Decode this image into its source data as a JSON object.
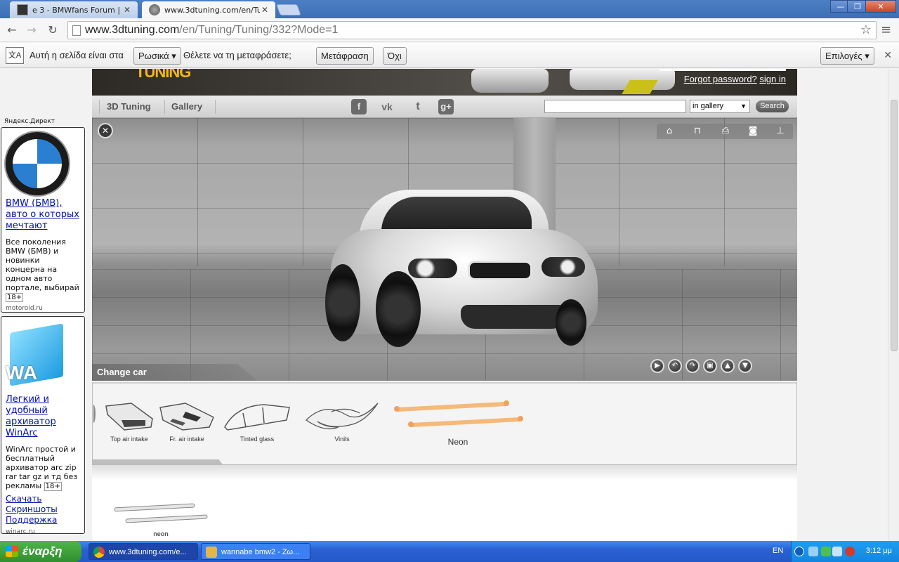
{
  "browser": {
    "tabs": [
      {
        "label": "e 3 - BMWfans Forum | | | | |",
        "active": false
      },
      {
        "label": "www.3dtuning.com/en/Tunin",
        "active": true
      }
    ],
    "url_host": "www.3dtuning.com",
    "url_path": "/en/Tuning/Tuning/332?Mode=1",
    "window_controls": {
      "minimize": "—",
      "maximize": "❐",
      "close": "✕"
    },
    "translate_bar": {
      "icon": "文A",
      "text_prefix": "Αυτή η σελίδα είναι στα",
      "language": "Ρωσικά",
      "question": "Θέλετε να τη μεταφράσετε;",
      "translate_button": "Μετάφραση",
      "no_button": "Όχι",
      "options_button": "Επιλογές"
    }
  },
  "ads": {
    "header": "Яндекс.Директ",
    "items": [
      {
        "title": "BMW (БМВ), авто о которых мечтают",
        "body": "Все поколения BMW (БМВ) и новинки концерна на одном авто портале, выбирай",
        "age": "18+",
        "domain": "motoroid.ru"
      },
      {
        "title": "Легкий и удобный архиватор WinArc",
        "body": "WinArc простой и бесплатный архиватор arc zip rar tar gz и тд без рекламы",
        "age": "18+",
        "links": [
          "Скачать",
          "Скриншоты",
          "Поддержка"
        ],
        "domain": "winarc.ru"
      }
    ]
  },
  "site": {
    "logo": "TUNING",
    "forgot_password": "Forgot password?",
    "sign_in": "sign in",
    "nav": [
      "3D Tuning",
      "Gallery"
    ],
    "social": [
      "f",
      "vk",
      "t",
      "g+"
    ],
    "search": {
      "placeholder": "",
      "scope": "in gallery",
      "button": "Search"
    },
    "viewer": {
      "change_car": "Change car",
      "top_tools": [
        "home-icon",
        "paint-roller-icon",
        "print-icon",
        "camera-icon",
        "sitemap-icon"
      ],
      "controls": [
        "play-icon",
        "rotate-left-icon",
        "rotate-right-icon",
        "lock-icon",
        "upload-icon",
        "download-icon"
      ]
    },
    "parts": [
      {
        "label": "Top air intake",
        "selected": false
      },
      {
        "label": "Fr. air intake",
        "selected": false
      },
      {
        "label": "Tinted glass",
        "selected": false
      },
      {
        "label": "Vinils",
        "selected": false
      },
      {
        "label": "Neon",
        "selected": true
      }
    ],
    "subparts": [
      {
        "label": "neon"
      }
    ]
  },
  "taskbar": {
    "start": "έναρξη",
    "tasks": [
      {
        "label": "www.3dtuning.com/e...",
        "active": true
      },
      {
        "label": "wannabe bmw2 - Ζω...",
        "active": false
      }
    ],
    "lang": "EN",
    "clock": "3:12 μμ"
  },
  "colors": {
    "neon_accent": "#f5b97a",
    "taskbar": "#2459c9",
    "start": "#318e2e",
    "logo": "#f2b814"
  }
}
